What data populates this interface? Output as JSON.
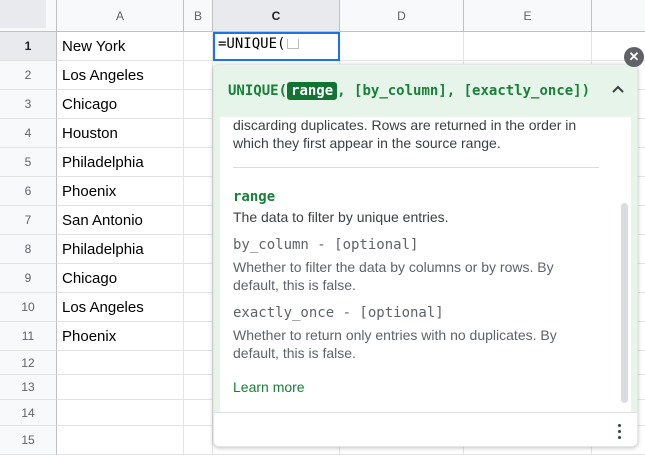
{
  "columns": [
    "A",
    "B",
    "C",
    "D",
    "E"
  ],
  "rows": [
    "1",
    "2",
    "3",
    "4",
    "5",
    "6",
    "7",
    "8",
    "9",
    "10",
    "11",
    "12",
    "13",
    "14",
    "15"
  ],
  "column_a": [
    "New York",
    "Los Angeles",
    "Chicago",
    "Houston",
    "Philadelphia",
    "Phoenix",
    "San Antonio",
    "Philadelphia",
    "Chicago",
    "Los Angeles",
    "Phoenix"
  ],
  "active_cell": {
    "formula": "=UNIQUE("
  },
  "popup": {
    "sig_func": "UNIQUE(",
    "sig_active_param": "range",
    "sig_rest": ", [by_column], [exactly_once])",
    "description": "discarding duplicates. Rows are returned in the order in which they first appear in the source range.",
    "params": [
      {
        "name": "range",
        "desc": "The data to filter by unique entries."
      },
      {
        "name": "by_column - [optional]",
        "desc": "Whether to filter the data by columns or by rows. By default, this is false."
      },
      {
        "name": "exactly_once - [optional]",
        "desc": "Whether to return only entries with no duplicates. By default, this is false."
      }
    ],
    "learn_more": "Learn more"
  },
  "icons": {
    "close": "close-icon",
    "collapse": "chevron-up-icon",
    "more": "more-vert-icon"
  },
  "colors": {
    "accent": "#188038",
    "selection": "#1a73e8",
    "header_bg": "#e6f4ea"
  }
}
